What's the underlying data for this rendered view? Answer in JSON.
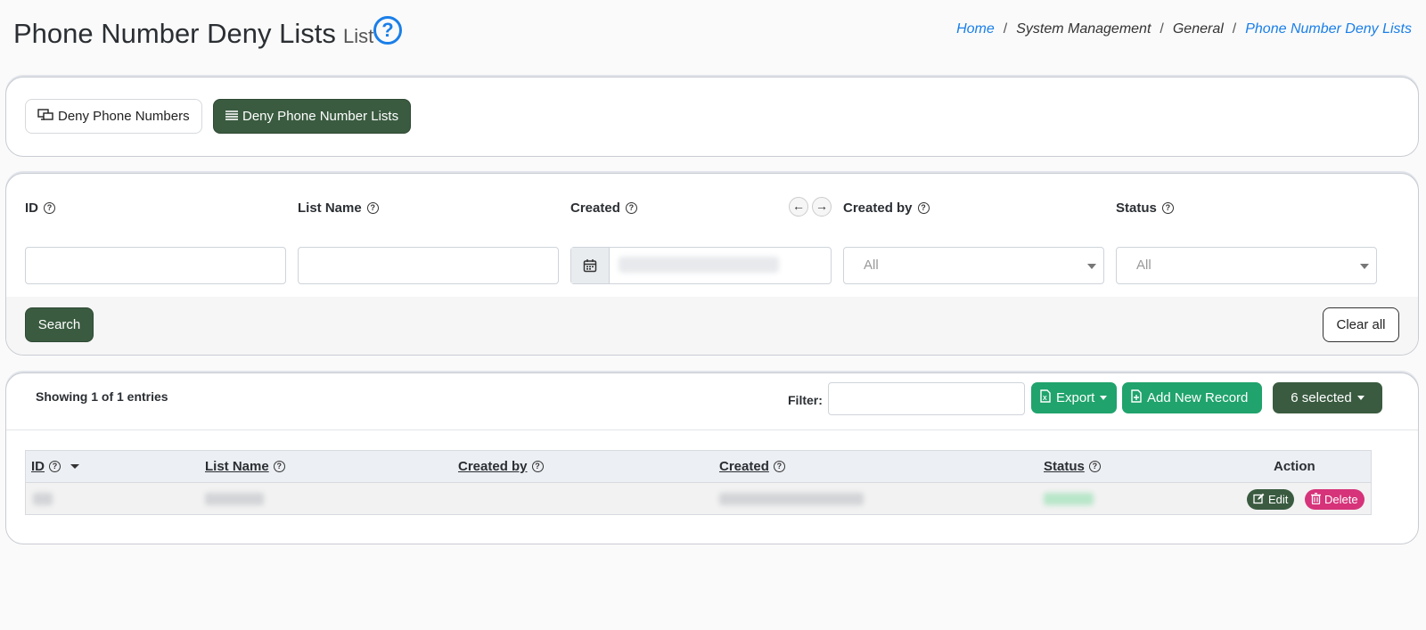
{
  "header": {
    "title": "Phone Number Deny Lists",
    "subtitle": "List",
    "help_icon": "question-circle-icon",
    "breadcrumb": [
      {
        "label": "Home",
        "link": true
      },
      {
        "label": "System Management",
        "link": false
      },
      {
        "label": "General",
        "link": false
      },
      {
        "label": "Phone Number Deny Lists",
        "link": true
      }
    ],
    "breadcrumb_sep": "/"
  },
  "tabs": [
    {
      "label": "Deny Phone Numbers",
      "icon": "monitor-network-icon",
      "active": false
    },
    {
      "label": "Deny Phone Number Lists",
      "icon": "list-icon",
      "active": true
    }
  ],
  "search": {
    "fields": [
      {
        "label": "ID",
        "type": "text",
        "value": ""
      },
      {
        "label": "List Name",
        "type": "text",
        "value": ""
      },
      {
        "label": "Created",
        "type": "daterange",
        "value": ""
      },
      {
        "label": "Created by",
        "type": "select",
        "value": "All"
      },
      {
        "label": "Status",
        "type": "select",
        "value": "All"
      }
    ],
    "search_label": "Search",
    "clear_label": "Clear all"
  },
  "table_toolbar": {
    "showing": "Showing 1 of 1 entries",
    "filter_label": "Filter:",
    "filter_value": "",
    "export_label": "Export",
    "add_label": "Add New Record",
    "selected_label": "6 selected"
  },
  "table": {
    "columns": [
      "ID",
      "List Name",
      "Created by",
      "Created",
      "Status",
      "Action"
    ],
    "rows": [
      {
        "edit_label": "Edit",
        "delete_label": "Delete"
      }
    ]
  },
  "colors": {
    "primary_dark_green": "#3a5b40",
    "accent_green": "#20a36c",
    "link_blue": "#1a7fe8",
    "delete_pink": "#d6337a"
  }
}
